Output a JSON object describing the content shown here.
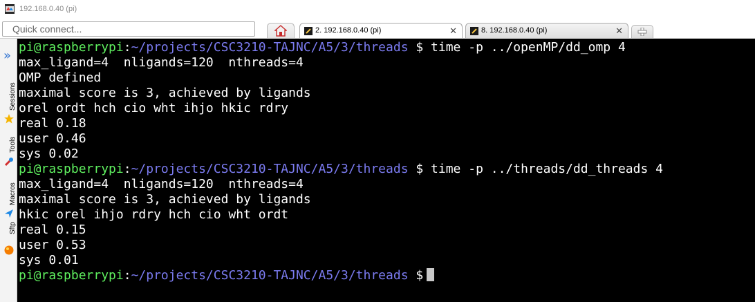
{
  "window": {
    "title": "192.168.0.40 (pi)",
    "icon": "mobaxterm-app-icon"
  },
  "toolbar": {
    "quick_connect_placeholder": "Quick connect..."
  },
  "tabs": [
    {
      "label": "2. 192.168.0.40 (pi)",
      "active": true,
      "icon": "terminal-icon"
    },
    {
      "label": "8. 192.168.0.40 (pi)",
      "active": false,
      "icon": "terminal-icon"
    }
  ],
  "sidebar": {
    "items": [
      {
        "label": "Sessions",
        "icon": "star-icon"
      },
      {
        "label": "Tools",
        "icon": "tools-icon"
      },
      {
        "label": "Macros",
        "icon": "macro-arrow-icon"
      },
      {
        "label": "Sftp",
        "icon": "sftp-globe-icon"
      }
    ]
  },
  "terminal": {
    "user": "pi@raspberrypi",
    "path": "~/projects/CSC3210-TAJNC/A5/3/threads",
    "lines": [
      {
        "kind": "prompt",
        "cmd": "time -p ../openMP/dd_omp 4"
      },
      {
        "kind": "out",
        "text": "max_ligand=4  nligands=120  nthreads=4"
      },
      {
        "kind": "out",
        "text": "OMP defined"
      },
      {
        "kind": "out",
        "text": "maximal score is 3, achieved by ligands"
      },
      {
        "kind": "out",
        "text": "orel ordt hch cio wht ihjo hkic rdry"
      },
      {
        "kind": "out",
        "text": "real 0.18"
      },
      {
        "kind": "out",
        "text": "user 0.46"
      },
      {
        "kind": "out",
        "text": "sys 0.02"
      },
      {
        "kind": "prompt",
        "cmd": "time -p ../threads/dd_threads 4"
      },
      {
        "kind": "out",
        "text": "max_ligand=4  nligands=120  nthreads=4"
      },
      {
        "kind": "out",
        "text": "maximal score is 3, achieved by ligands"
      },
      {
        "kind": "out",
        "text": "hkic orel ihjo rdry hch cio wht ordt"
      },
      {
        "kind": "out",
        "text": "real 0.15"
      },
      {
        "kind": "out",
        "text": "user 0.53"
      },
      {
        "kind": "out",
        "text": "sys 0.01"
      },
      {
        "kind": "prompt",
        "cmd": ""
      }
    ]
  },
  "colors": {
    "terminal_bg": "#000000",
    "user_color": "#5ff05f",
    "path_color": "#7b7bf0",
    "text_color": "#ffffff"
  }
}
